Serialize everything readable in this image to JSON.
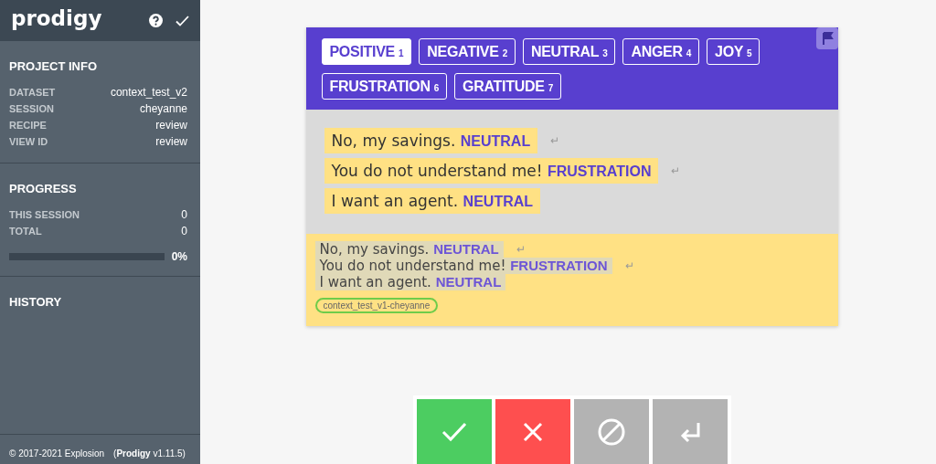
{
  "sidebar": {
    "logo": "prodigy",
    "sections": [
      {
        "title": "PROJECT INFO",
        "rows": [
          {
            "label": "DATASET",
            "value": "context_test_v2"
          },
          {
            "label": "SESSION",
            "value": "cheyanne"
          },
          {
            "label": "RECIPE",
            "value": "review"
          },
          {
            "label": "VIEW ID",
            "value": "review"
          }
        ]
      },
      {
        "title": "PROGRESS",
        "rows": [
          {
            "label": "THIS SESSION",
            "value": "0"
          },
          {
            "label": "TOTAL",
            "value": "0"
          }
        ],
        "progress": {
          "level": 0,
          "reading": "0%"
        }
      },
      {
        "title": "HISTORY"
      }
    ],
    "footer": {
      "copyright": "© 2017-2021 Explosion",
      "version": "(**Prodigy** v1.11.5)"
    }
  },
  "labels": [
    {
      "text": "POSITIVE",
      "key": "1",
      "selected": true
    },
    {
      "text": "NEGATIVE",
      "key": "2",
      "selected": false
    },
    {
      "text": "NEUTRAL",
      "key": "3",
      "selected": false
    },
    {
      "text": "ANGER",
      "key": "4",
      "selected": false
    },
    {
      "text": "JOY",
      "key": "5",
      "selected": false
    },
    {
      "text": "FRUSTRATION",
      "key": "6",
      "selected": false
    },
    {
      "text": "GRATITUDE",
      "key": "7",
      "selected": false
    }
  ],
  "task": {
    "spans": [
      {
        "text": "No, my savings.",
        "label": "NEUTRAL",
        "return_mark": "↵"
      },
      {
        "text": "You do not understand me!",
        "label": "FRUSTRATION",
        "return_mark": "↵"
      },
      {
        "text": "I want an agent.",
        "label": "NEUTRAL"
      }
    ]
  },
  "version": {
    "spans": [
      {
        "text": "No, my savings.",
        "label": "NEUTRAL",
        "return_mark": "↵"
      },
      {
        "text": "You do not understand me!",
        "label": "FRUSTRATION",
        "return_mark": "↵"
      },
      {
        "text": "I want an agent.",
        "label": "NEUTRAL"
      }
    ],
    "session_tag": "context_test_v1-cheyanne"
  },
  "actions": [
    {
      "kind": "accept"
    },
    {
      "kind": "reject"
    },
    {
      "kind": "ignore"
    },
    {
      "kind": "undo"
    }
  ]
}
